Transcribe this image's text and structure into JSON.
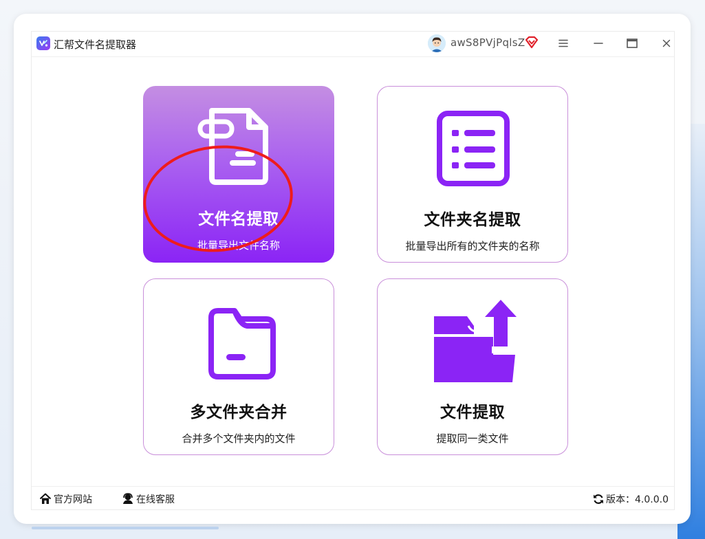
{
  "app": {
    "title": "汇帮文件名提取器",
    "logo_icon": "app-logo-icon"
  },
  "user": {
    "avatar_icon": "user-avatar-icon",
    "name": "awS8PVjPqlsZ",
    "vip_icon": "vip-diamond-icon"
  },
  "window_controls": {
    "menu_icon": "hamburger-menu-icon",
    "minimize_icon": "minimize-icon",
    "maximize_icon": "maximize-icon",
    "close_icon": "close-icon"
  },
  "tiles": [
    {
      "title": "文件名提取",
      "desc": "批量导出文件名称",
      "icon": "document-icon",
      "active": true
    },
    {
      "title": "文件夹名提取",
      "desc": "批量导出所有的文件夹的名称",
      "icon": "list-icon",
      "active": false
    },
    {
      "title": "多文件夹合并",
      "desc": "合并多个文件夹内的文件",
      "icon": "folder-icon",
      "active": false
    },
    {
      "title": "文件提取",
      "desc": "提取同一类文件",
      "icon": "folder-upload-icon",
      "active": false
    }
  ],
  "footer": {
    "website_label": "官方网站",
    "service_label": "在线客服",
    "version_label": "版本：4.0.0.0"
  },
  "colors": {
    "accent_purple": "#8b24f5",
    "tile_border": "#c98fda",
    "highlight_ring": "#ee1c1c",
    "vip_red": "#e0212b"
  }
}
